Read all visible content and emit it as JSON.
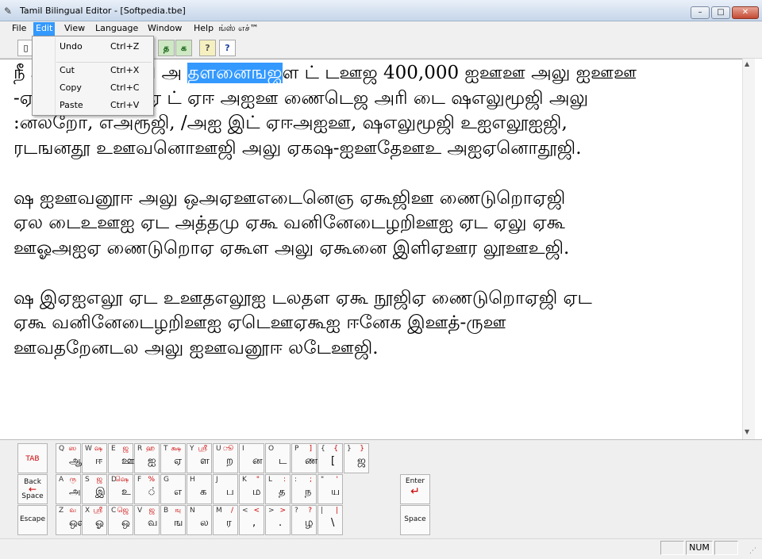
{
  "window": {
    "title": "Tamil Bilingual Editor - [Softpedia.tbe]",
    "min_label": "–",
    "max_label": "□",
    "close_label": "✕"
  },
  "menu": [
    "File",
    "Edit",
    "View",
    "Language",
    "Window",
    "Help",
    "ங்ஸ் எச்™"
  ],
  "edit_menu": [
    {
      "label": "Undo",
      "shortcut": "Ctrl+Z"
    },
    {
      "label": "Cut",
      "shortcut": "Ctrl+X"
    },
    {
      "label": "Copy",
      "shortcut": "Ctrl+C"
    },
    {
      "label": "Paste",
      "shortcut": "Ctrl+V"
    }
  ],
  "toolbar": {
    "tamil_label_1": "த",
    "tamil_label_2": "க",
    "help_label": "?",
    "context_help_label": "?"
  },
  "document": {
    "lines": [
      {
        "pre": "நீ அ ஐ ஊ ள ணி அ ",
        "sel": "தளனைஙஜ",
        "post": "ள ட் டஊஜ 400,000 ஐஊஊ அலு ஐஊஊ"
      },
      {
        "pre": "-ஏஐ ஊஐ ஐ ஊ ஏ ட் ஏஈ அஐஊ ணைடெஜ அரி டை ஷஎலுமூஜி அலு",
        "sel": "",
        "post": ""
      },
      {
        "pre": ":னலறோ, எஅரூஜி, /அஐ இட் ஏஈஅஐஊ, ஷஎலுமூஜி உஐஎலூஐஜி,",
        "sel": "",
        "post": ""
      },
      {
        "pre": "ரடஙனதூ உஊவனொஊஜி அலு ஏகஷ-ஐஊதேஊஉ அஐஏனொதூஜி.",
        "sel": "",
        "post": ""
      },
      {
        "pre": "",
        "sel": "",
        "post": ""
      },
      {
        "pre": "ஷ ஐஊவனூஈ அலு ஒஅஏஊஎடைனெஞ ஏகூஜிஊ ணைடுறொஏஜி",
        "sel": "",
        "post": ""
      },
      {
        "pre": "ஏல டைஉஊஐ ஏட அத்தமு ஏகூ வனினேடைழறிஊஐ ஏட ஏலு ஏகூ",
        "sel": "",
        "post": ""
      },
      {
        "pre": "ஊஓஅஐஏ ணைடுறொஏ ஏகூள அலு ஏகூனை இளிஏஊர லூஊஉஜி.",
        "sel": "",
        "post": ""
      },
      {
        "pre": "",
        "sel": "",
        "post": ""
      },
      {
        "pre": "ஷ இஏஐஎலூ ஏட உஊதஎலூஐ டலதள ஏகூ நூஜிஏ ணைடுறொஏஜி ஏட",
        "sel": "",
        "post": ""
      },
      {
        "pre": "ஏகூ வனினேடைழறிஊஐ ஏடெஊஏகூஐ ஈனேக இஊத்-ருஊ",
        "sel": "",
        "post": ""
      },
      {
        "pre": "ஊவதறேனடல அலு ஐஊவனூஈ லடேஊஜி.",
        "sel": "",
        "post": ""
      }
    ]
  },
  "keyboard": {
    "tab_label": "TAB",
    "backspace_label_1": "Back",
    "backspace_label_2": "Space",
    "escape_label": "Escape",
    "enter_label": "Enter",
    "space_label": "Space",
    "row1": [
      {
        "l": "Q",
        "t": "ஸ",
        "b": "ஆ"
      },
      {
        "l": "W",
        "t": "ஷ",
        "b": "ஈ"
      },
      {
        "l": "E",
        "t": "ஜ",
        "b": "ஊ"
      },
      {
        "l": "R",
        "t": "ஹ",
        "b": "ஐ"
      },
      {
        "l": "T",
        "t": "க்ஷ",
        "b": "ஏ"
      },
      {
        "l": "Y",
        "t": "ஸ்ரீ",
        "b": "ள"
      },
      {
        "l": "U",
        "t": "ூ",
        "b": "ற"
      },
      {
        "l": "I",
        "t": "",
        "b": "ன"
      },
      {
        "l": "O",
        "t": "",
        "b": "ட"
      },
      {
        "l": "P",
        "t": "]",
        "b": "ண"
      },
      {
        "l": "{",
        "t": "{",
        "b": "["
      },
      {
        "l": "}",
        "t": "}",
        "b": "ஜ"
      }
    ],
    "row2": [
      {
        "l": "A",
        "t": "ரு",
        "b": "அ"
      },
      {
        "l": "S",
        "t": "ஜ",
        "b": "இ"
      },
      {
        "l": "D",
        "t": "ஷெ",
        "b": "உ"
      },
      {
        "l": "F",
        "t": "%",
        "b": "்"
      },
      {
        "l": "G",
        "t": "",
        "b": "எ"
      },
      {
        "l": "H",
        "t": "",
        "b": "க"
      },
      {
        "l": "J",
        "t": "",
        "b": "ப"
      },
      {
        "l": "K",
        "t": "\"",
        "b": "ம"
      },
      {
        "l": "L",
        "t": ":",
        "b": "த"
      },
      {
        "l": ":",
        "t": ";",
        "b": "ந"
      },
      {
        "l": "\"",
        "t": "'",
        "b": "ய"
      }
    ],
    "row3": [
      {
        "l": "Z",
        "t": "வ",
        "b": "ஔ"
      },
      {
        "l": "X",
        "t": "ஸ்ரீ",
        "b": "ஓ"
      },
      {
        "l": "C",
        "t": "ஜெ",
        "b": "ஒ"
      },
      {
        "l": "V",
        "t": "ஜ",
        "b": "வ"
      },
      {
        "l": "B",
        "t": "ஙு",
        "b": "ங"
      },
      {
        "l": "N",
        "t": "",
        "b": "ல"
      },
      {
        "l": "M",
        "t": "/",
        "b": "ர"
      },
      {
        "l": "<",
        "t": "<",
        "b": ","
      },
      {
        "l": ">",
        "t": ">",
        "b": "."
      },
      {
        "l": "?",
        "t": "?",
        "b": "ழ"
      },
      {
        "l": "|",
        "t": "|",
        "b": "\\"
      }
    ]
  },
  "status": {
    "num": "NUM"
  }
}
